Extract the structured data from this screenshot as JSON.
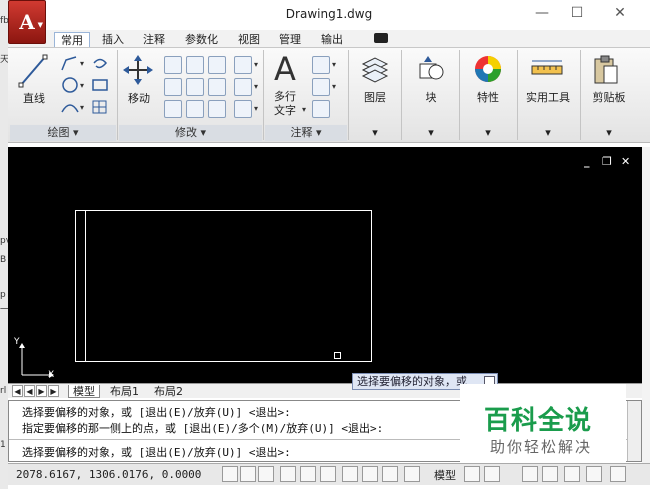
{
  "window": {
    "title": "Drawing1.dwg",
    "app_icon_letter": "A",
    "controls": {
      "minimize": "—",
      "maximize": "☐",
      "close": "✕"
    }
  },
  "behind_window": {
    "glyphs": [
      "fb",
      "天",
      "pv",
      "B",
      "p",
      "一",
      "rl",
      "1"
    ]
  },
  "ribbon": {
    "tabs": [
      "常用",
      "插入",
      "注释",
      "参数化",
      "视图",
      "管理",
      "输出"
    ],
    "active_tab": "常用",
    "panels": {
      "draw": {
        "label": "绘图 ▾",
        "big_button": "直线"
      },
      "modify": {
        "label": "修改 ▾",
        "big_button": "移动"
      },
      "annotate": {
        "label": "注释 ▾",
        "big_button_line1": "多行",
        "big_button_line2": "文字"
      },
      "layers": {
        "big_button": "图层",
        "arrow": "▾"
      },
      "block": {
        "big_button": "块",
        "arrow": "▾"
      },
      "properties": {
        "big_button": "特性",
        "arrow": "▾"
      },
      "utilities": {
        "big_button": "实用工具",
        "arrow": "▾"
      },
      "clipboard": {
        "big_button": "剪贴板",
        "arrow": "▾"
      }
    },
    "big_icon_glyph": "A"
  },
  "viewport_controls": {
    "minimize": "_",
    "restore": "❐",
    "close": "✕"
  },
  "ucs": {
    "y": "Y",
    "x": "X"
  },
  "layout_tabs": {
    "nav": [
      "◀",
      "◀",
      "▶",
      "▶"
    ],
    "tabs": [
      "模型",
      "布局1",
      "布局2"
    ],
    "active": "模型"
  },
  "tooltip": {
    "text": "选择要偏移的对象，或"
  },
  "command_window": {
    "lines": [
      "选择要偏移的对象，或 [退出(E)/放弃(U)] <退出>:",
      "指定要偏移的那一侧上的点，或 [退出(E)/多个(M)/放弃(U)] <退出>:",
      "选择要偏移的对象，或 [退出(E)/放弃(U)] <退出>:"
    ]
  },
  "watermark": {
    "main": "百科全说",
    "sub": "助你轻松解决"
  },
  "status_bar": {
    "coords": "2078.6167, 1306.0176, 0.0000",
    "model_label": "模型"
  }
}
